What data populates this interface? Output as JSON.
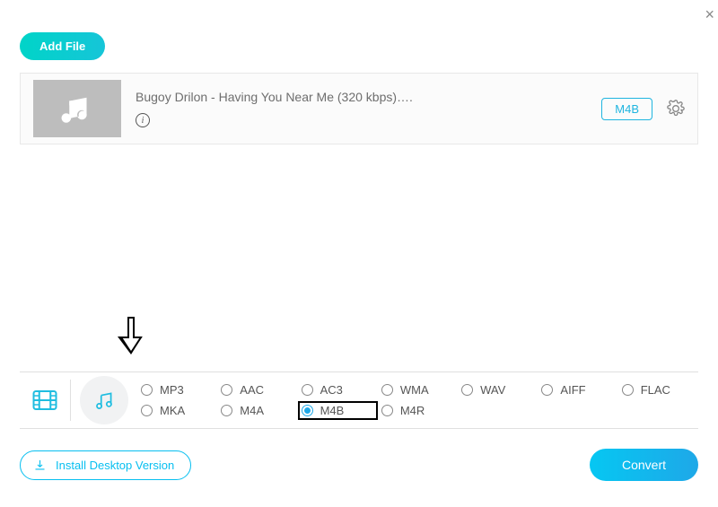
{
  "close_label": "×",
  "add_file_label": "Add File",
  "file": {
    "title": "Bugoy Drilon - Having You Near Me (320 kbps)….",
    "format_badge": "M4B"
  },
  "formats": {
    "row1": [
      "MP3",
      "AAC",
      "AC3",
      "WMA",
      "WAV",
      "AIFF",
      "FLAC"
    ],
    "row2": [
      "MKA",
      "M4A",
      "M4B",
      "M4R"
    ],
    "selected": "M4B",
    "highlighted": "M4B"
  },
  "install_label": "Install Desktop Version",
  "convert_label": "Convert"
}
